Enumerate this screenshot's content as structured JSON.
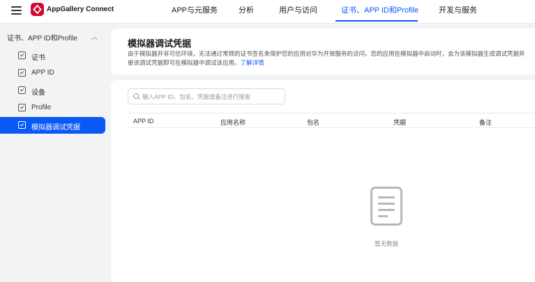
{
  "topbar": {
    "brand": "AppGallery Connect",
    "nav": [
      {
        "label": "APP与元服务"
      },
      {
        "label": "分析"
      },
      {
        "label": "用户与访问"
      },
      {
        "label": "证书、APP ID和Profile"
      },
      {
        "label": "开发与服务"
      }
    ],
    "active_nav": "证书、APP ID和Profile"
  },
  "sidebar": {
    "group_label": "证书、APP ID和Profile",
    "items": [
      {
        "label": "证书"
      },
      {
        "label": "APP ID"
      },
      {
        "label": "设备"
      },
      {
        "label": "Profile"
      },
      {
        "label": "模拟器调试凭据"
      }
    ],
    "active_item": "模拟器调试凭据"
  },
  "header": {
    "title": "模拟器调试凭据",
    "desc_line1": "由于模拟器并非可信环境，无法通过常规的证书签名来保护您的应用对华为开放服务的访问。您的应用在模拟器中启动时，会为该模拟器生成调试凭据并",
    "desc_line2": "册该调试凭据即可在模拟器中调试该应用。",
    "learn_more": "了解详情"
  },
  "search": {
    "placeholder": "输入APP ID、包名、凭据或备注进行搜索",
    "value": ""
  },
  "table": {
    "columns": [
      "APP ID",
      "应用名称",
      "包名",
      "凭据",
      "备注"
    ],
    "rows": []
  },
  "empty_state": {
    "text": "暂无数据",
    "icon": "document-icon"
  },
  "colors": {
    "accent": "#0a59f7",
    "brand_logo": "#cf0a2c"
  }
}
